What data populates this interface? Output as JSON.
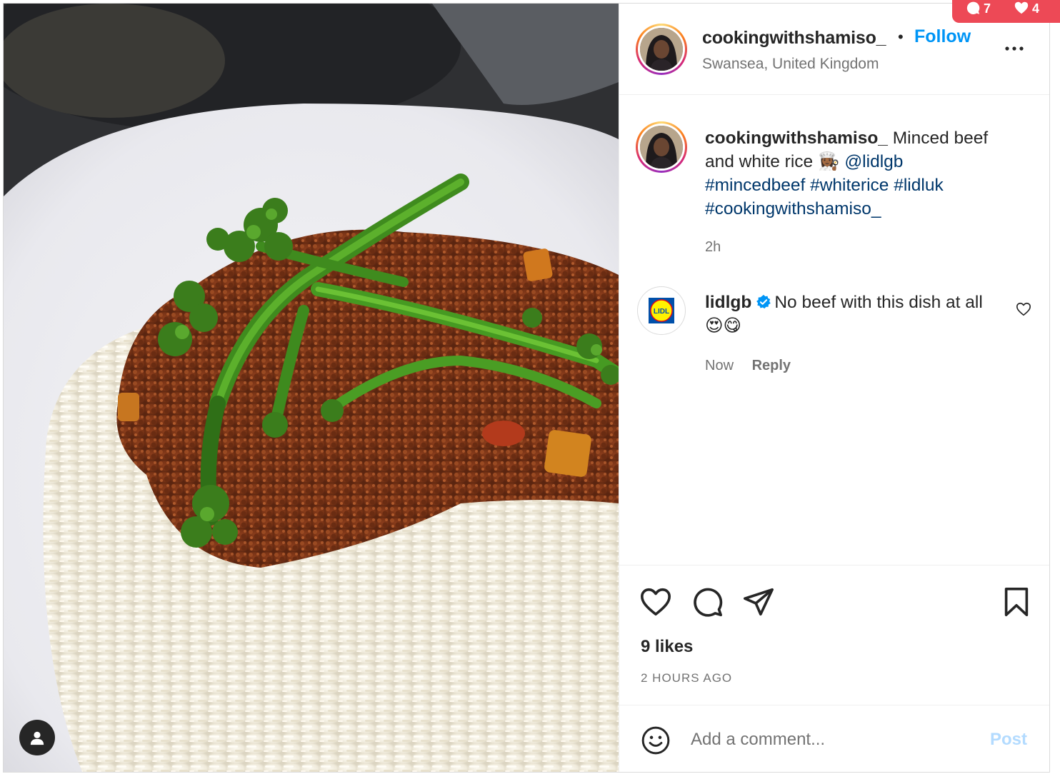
{
  "post": {
    "username": "cookingwithshamiso_",
    "separator": "•",
    "follow_label": "Follow",
    "location": "Swansea, United Kingdom",
    "more_icon": "more-horizontal-icon",
    "photo_alt": "Minced beef with tenderstem broccoli on white rice"
  },
  "caption": {
    "username": "cookingwithshamiso_",
    "text": "Minced beef and white rice",
    "emoji": "👩🏾‍🍳",
    "mention": "@lidlgb",
    "hashtags": [
      "#mincedbeef",
      "#whiterice",
      "#lidluk",
      "#cookingwithshamiso_"
    ],
    "time": "2h"
  },
  "comment": {
    "username": "lidlgb",
    "verified": true,
    "text": "No beef with this dish at all",
    "emoji": "😍😋",
    "time": "Now",
    "reply_label": "Reply"
  },
  "actions": {
    "likes": "9 likes",
    "time_ago": "2 HOURS AGO",
    "icons": [
      "heart-icon",
      "comment-icon",
      "share-icon",
      "bookmark-icon"
    ]
  },
  "composer": {
    "placeholder": "Add a comment...",
    "post_label": "Post"
  },
  "notification": {
    "comments": "7",
    "likes": "4"
  },
  "colors": {
    "accent": "#0095f6",
    "link": "#00376b",
    "muted": "#737373",
    "post_disabled": "#b3dbff",
    "notification": "#ed4956"
  }
}
